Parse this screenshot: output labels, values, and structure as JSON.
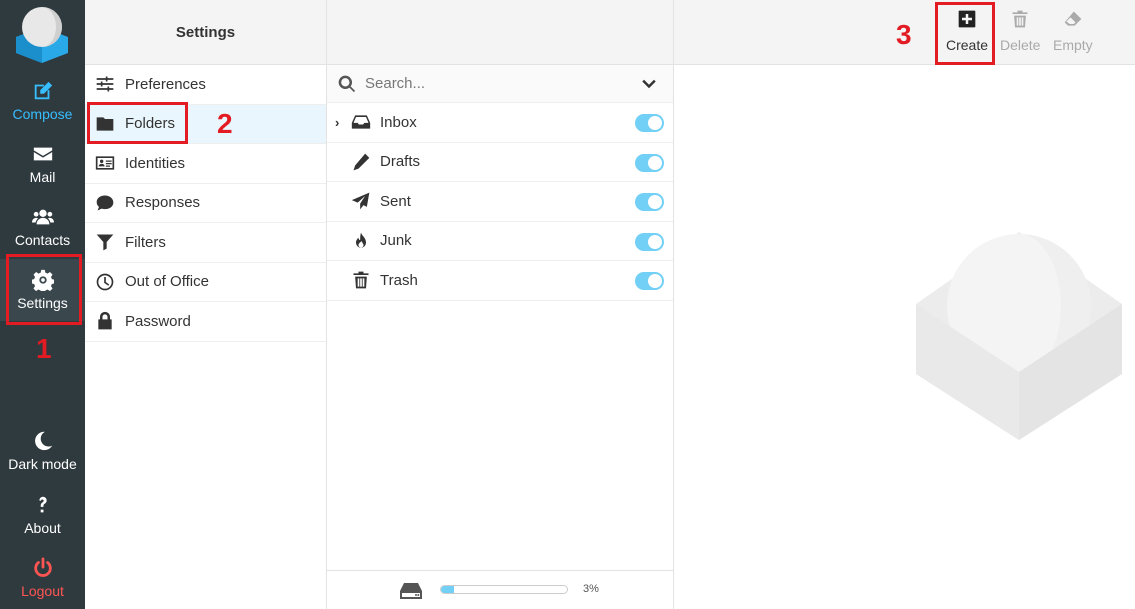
{
  "nav": {
    "compose": "Compose",
    "mail": "Mail",
    "contacts": "Contacts",
    "settings": "Settings",
    "dark_mode": "Dark mode",
    "about": "About",
    "logout": "Logout"
  },
  "settings_panel": {
    "title": "Settings",
    "items": [
      {
        "label": "Preferences",
        "icon": "sliders-icon"
      },
      {
        "label": "Folders",
        "icon": "folder-icon"
      },
      {
        "label": "Identities",
        "icon": "id-card-icon"
      },
      {
        "label": "Responses",
        "icon": "comment-icon"
      },
      {
        "label": "Filters",
        "icon": "filter-icon"
      },
      {
        "label": "Out of Office",
        "icon": "clock-icon"
      },
      {
        "label": "Password",
        "icon": "lock-icon"
      }
    ]
  },
  "folders_panel": {
    "search_placeholder": "Search...",
    "folders": [
      {
        "name": "Inbox",
        "icon": "inbox-icon",
        "subscribed": true
      },
      {
        "name": "Drafts",
        "icon": "pencil-icon",
        "subscribed": true
      },
      {
        "name": "Sent",
        "icon": "paper-plane-icon",
        "subscribed": true
      },
      {
        "name": "Junk",
        "icon": "fire-icon",
        "subscribed": true
      },
      {
        "name": "Trash",
        "icon": "trash-icon",
        "subscribed": true
      }
    ],
    "quota_text": "3%",
    "quota_fraction": 0.03
  },
  "toolbar": {
    "create": "Create",
    "delete": "Delete",
    "empty": "Empty"
  },
  "annotations": {
    "step1": "1",
    "step2": "2",
    "step3": "3"
  },
  "colors": {
    "nav_bg": "#2f3a3f",
    "accent": "#37beff",
    "logout": "#ff5552",
    "annotation_red": "#e31b23",
    "toggle_on": "#72cff5"
  }
}
